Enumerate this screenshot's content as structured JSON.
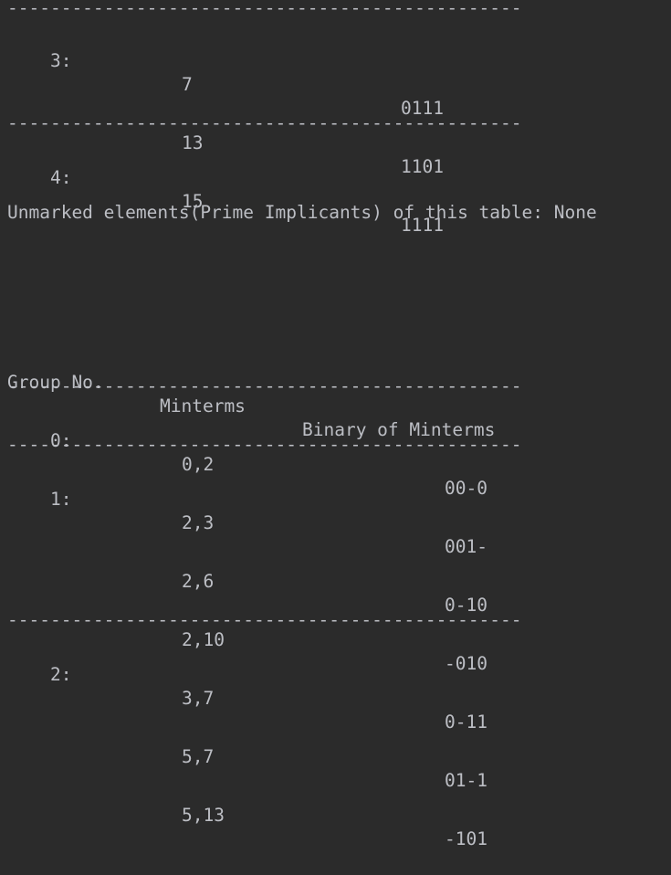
{
  "separator": "------------------------------------------------",
  "table1": {
    "rows": [
      {
        "group": "3:",
        "minterm": "7",
        "binary": "0111"
      },
      {
        "group": "",
        "minterm": "13",
        "binary": "1101"
      },
      {
        "group": "4:",
        "minterm": "15",
        "binary": "1111"
      }
    ],
    "summary": "Unmarked elements(Prime Implicants) of this table: None"
  },
  "table2": {
    "header": {
      "group": "Group No.",
      "minterms": "Minterms",
      "binary": "Binary of Minterms"
    },
    "rows": [
      {
        "group": "0:",
        "minterm": "0,2",
        "binary": "00-0"
      },
      {
        "group": "1:",
        "minterm": "2,3",
        "binary": "001-"
      },
      {
        "group": "",
        "minterm": "2,6",
        "binary": "0-10"
      },
      {
        "group": "",
        "minterm": "2,10",
        "binary": "-010"
      },
      {
        "group": "2:",
        "minterm": "3,7",
        "binary": "0-11"
      },
      {
        "group": "",
        "minterm": "5,7",
        "binary": "01-1"
      },
      {
        "group": "",
        "minterm": "5,13",
        "binary": "-101"
      }
    ]
  }
}
